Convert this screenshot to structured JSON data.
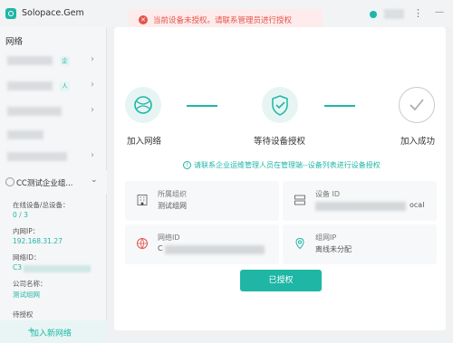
{
  "app": {
    "title": "Solopace.Gem"
  },
  "alert": {
    "message": "当前设备未授权。请联系管理员进行授权"
  },
  "sidebar": {
    "title": "网络",
    "network_tags": [
      "企",
      "人"
    ],
    "current_network": "CC测试企业组...",
    "online_devices_label": "在线设备/总设备：",
    "online_devices_value": "0 / 3",
    "intranet_ip_label": "内网IP：",
    "intranet_ip_value": "192.168.31.27",
    "network_id_label": "网络ID：",
    "network_id_value_prefix": "C3",
    "company_label": "公司名称：",
    "company_value": "测试组网",
    "status_label": "待授权",
    "add_network_label": "加入新网络"
  },
  "steps": [
    {
      "label": "加入网络",
      "icon": "globe-icon"
    },
    {
      "label": "等待设备授权",
      "icon": "shield-check-icon"
    },
    {
      "label": "加入成功",
      "icon": "check-icon"
    }
  ],
  "hint": "请联系企业运维管理人员在管理端--设备列表进行设备授权",
  "cards": {
    "org": {
      "label": "所属组织",
      "value": "测试组网"
    },
    "device": {
      "label_partial": "设备 ID",
      "value_suffix": "ocal"
    },
    "network_id": {
      "label_partial": "网络ID",
      "value_prefix": "C"
    },
    "network_ip": {
      "label": "组网IP",
      "value": "离线未分配"
    }
  },
  "authorized_button": "已授权",
  "colors": {
    "accent": "#1fb6a6",
    "error": "#e5534b"
  }
}
